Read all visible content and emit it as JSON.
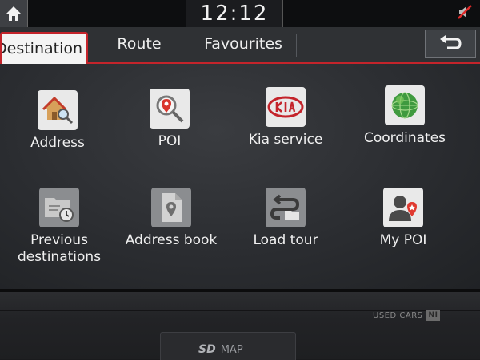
{
  "status": {
    "time": "12:12",
    "icons": [
      "home-icon",
      "mute-icon"
    ]
  },
  "tabs": [
    {
      "label": "Destination",
      "active": true
    },
    {
      "label": "Route",
      "active": false
    },
    {
      "label": "Favourites",
      "active": false
    }
  ],
  "items": [
    {
      "label": "Address",
      "icon": "house-search-icon"
    },
    {
      "label": "POI",
      "icon": "poi-search-icon"
    },
    {
      "label": "Kia service",
      "icon": "kia-logo-icon"
    },
    {
      "label": "Coordinates",
      "icon": "globe-icon"
    },
    {
      "label": "Previous destinations",
      "icon": "history-folder-icon"
    },
    {
      "label": "Address book",
      "icon": "address-book-icon"
    },
    {
      "label": "Load tour",
      "icon": "load-tour-icon"
    },
    {
      "label": "My POI",
      "icon": "my-poi-icon"
    }
  ],
  "bezel": {
    "watermark": "USED CARS",
    "watermark_badge": "NI",
    "sd_logo": "SD",
    "sd_label": "MAP"
  },
  "colors": {
    "accent": "#c4242b",
    "text": "#f0f0f0",
    "background": "#2b2d31"
  }
}
